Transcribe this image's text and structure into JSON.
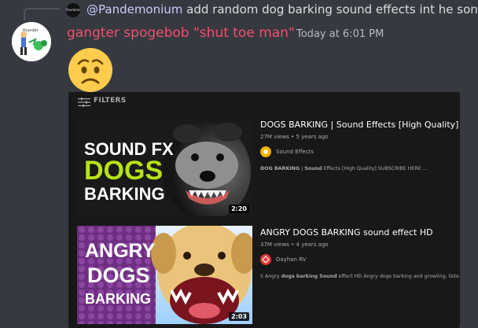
{
  "reply": {
    "avatar_text": "Pandemonium",
    "mention": "@Pandemonium",
    "text": " add random dog barking sound effects int he song"
  },
  "message": {
    "username": "gangter spogebob \"shut toe man\"",
    "timestamp": "Today at 6:01 PM",
    "emoji": "worried-face",
    "avatar_text": "thunder"
  },
  "embed": {
    "filters_label": "FILTERS",
    "results": [
      {
        "title": "DOGS BARKING | Sound Effects [High Quality]",
        "meta": "27M views • 5 years ago",
        "channel": "Sound Effects",
        "description_bold_1": "DOG BARKING",
        "description_sep": " | ",
        "description_bold_2": "Sound",
        "description_rest": " Effects [High Quality] SUBSCRIBE HERE ...",
        "duration": "2:20",
        "thumb_lines": [
          "SOUND FX",
          "DOGS",
          "BARKING"
        ],
        "channel_color": "#f4b400"
      },
      {
        "title": "ANGRY DOGS BARKING sound effect HD",
        "meta": "37M views • 4 years ago",
        "channel": "Dayhan RV",
        "description_pre": "5 Angry ",
        "description_bold_1": "dogs barking Sound",
        "description_rest": " effect HD Angry dogs barking and growling, liste",
        "duration": "2:03",
        "thumb_lines": [
          "ANGRY",
          "DOGS",
          "BARKING"
        ],
        "channel_color": "#e53935"
      }
    ]
  },
  "colors": {
    "background": "#36393f",
    "username": "#f0506e",
    "embed_bg": "#181818",
    "lime": "#b6e317",
    "purple": "#7a3a8e"
  }
}
